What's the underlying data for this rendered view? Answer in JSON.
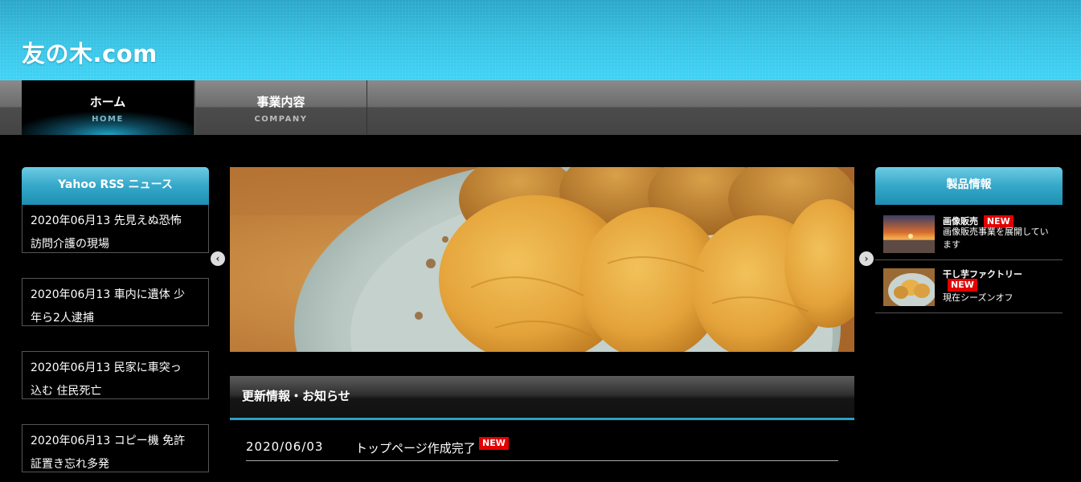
{
  "header": {
    "site_title": "友の木.com"
  },
  "nav": {
    "items": [
      {
        "label": "ホーム",
        "sub": "HOME"
      },
      {
        "label": "事業内容",
        "sub": "COMPANY"
      }
    ]
  },
  "left_sidebar": {
    "title": "Yahoo RSS ニュース",
    "items": [
      {
        "line1": "2020年06月13 先見えぬ恐怖",
        "line2": "訪問介護の現場"
      },
      {
        "line1": "2020年06月13 車内に遺体 少",
        "line2": "年ら2人逮捕"
      },
      {
        "line1": "2020年06月13 民家に車突っ",
        "line2": "込む 住民死亡"
      },
      {
        "line1": "2020年06月13 コピー機 免許",
        "line2": "証置き忘れ多発"
      }
    ]
  },
  "slider": {
    "prev_icon": "chevron-left-icon",
    "next_icon": "chevron-right-icon"
  },
  "news": {
    "title": "更新情報・お知らせ",
    "items": [
      {
        "date": "2020/06/03",
        "text": "トップページ作成完了",
        "badge": "NEW"
      }
    ]
  },
  "right_sidebar": {
    "title": "製品情報",
    "items": [
      {
        "title": "画像販売",
        "badge": "NEW",
        "desc": "画像販売事業を展開しています"
      },
      {
        "title": "干し芋ファクトリー",
        "badge": "NEW",
        "desc": "現在シーズンオフ"
      }
    ]
  },
  "colors": {
    "accent": "#2aa0c4",
    "badge": "#e30000",
    "header_top": "#2aa6c9",
    "header_bottom": "#3fd3f5"
  }
}
